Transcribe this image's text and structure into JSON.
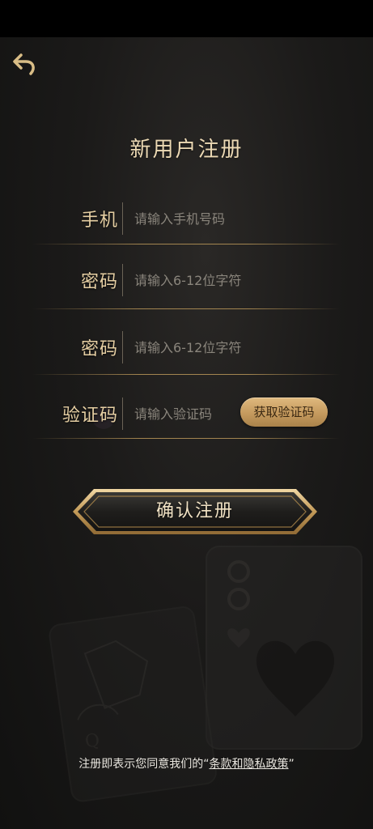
{
  "header": {
    "back_icon": "back-arrow-icon",
    "title": "新用户注册"
  },
  "form": {
    "phone": {
      "label": "手机",
      "placeholder": "请输入手机号码",
      "value": ""
    },
    "password": {
      "label": "密码",
      "placeholder": "请输入6-12位字符",
      "value": ""
    },
    "password_confirm": {
      "label": "密码",
      "placeholder": "请输入6-12位字符",
      "value": ""
    },
    "code": {
      "label": "验证码",
      "placeholder": "请输入验证码",
      "value": "",
      "button_label": "获取验证码"
    }
  },
  "confirm_button": {
    "label": "确认注册"
  },
  "terms": {
    "prefix": "注册即表示您同意我们的",
    "open_quote": "“",
    "link_text": "条款和隐私政策",
    "close_quote": "”"
  },
  "colors": {
    "accent_gold": "#c59a5e",
    "label_gold": "#e6cfa3",
    "background": "#1b1a19"
  }
}
